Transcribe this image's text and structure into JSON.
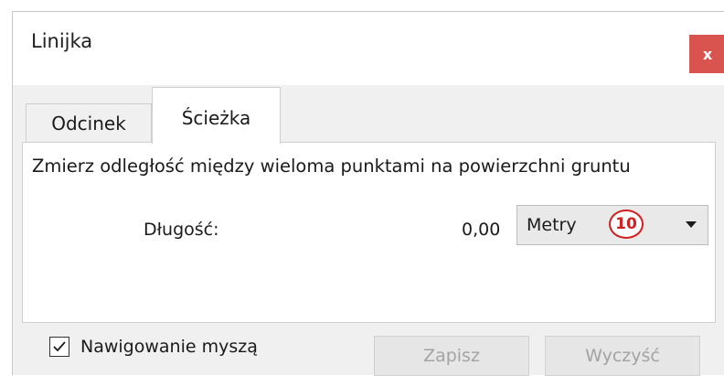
{
  "window": {
    "title": "Linijka",
    "close_label": "x"
  },
  "tabs": [
    {
      "label": "Odcinek",
      "active": false
    },
    {
      "label": "Ścieżka",
      "active": true
    }
  ],
  "panel": {
    "description": "Zmierz odległość między wieloma punktami na powierzchni gruntu",
    "length_label": "Długość:",
    "length_value": "0,00",
    "unit_selected": "Metry",
    "callout_number": "10"
  },
  "footer": {
    "mouse_nav_label": "Nawigowanie myszą",
    "mouse_nav_checked": true,
    "save_label": "Zapisz",
    "clear_label": "Wyczyść"
  },
  "colors": {
    "close_bg": "#d9534f",
    "callout": "#d21f1f"
  }
}
